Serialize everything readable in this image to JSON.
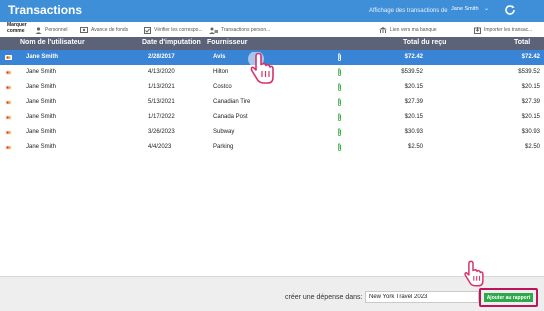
{
  "app": {
    "title": "Transactions",
    "view_label": "Affichage des transactions de",
    "selected_user": "Jane Smith"
  },
  "toolbar": {
    "mark_as_line1": "Marquer",
    "mark_as_line2": "comme",
    "items": [
      {
        "label": "Personnel",
        "icon": "person-icon"
      },
      {
        "label": "Avance de fonds",
        "icon": "cash-advance-icon"
      },
      {
        "label": "Vérifier les correspo...",
        "icon": "verify-match-icon"
      },
      {
        "label": "Transactions person...",
        "icon": "personal-transactions-icon"
      },
      {
        "label": "Lien vers ma banque",
        "icon": "bank-link-icon"
      },
      {
        "label": "Importer les transac...",
        "icon": "import-icon"
      }
    ]
  },
  "table": {
    "columns": {
      "user": "Nom de l'utilisateur",
      "date": "Date d'imputation",
      "vendor": "Fournisseur",
      "total_receipt": "Total du reçu",
      "total": "Total"
    },
    "rows": [
      {
        "user": "Jane Smith",
        "date": "2/28/2017",
        "vendor": "Avis",
        "total_receipt": "$72.42",
        "total": "$72.42",
        "selected": true
      },
      {
        "user": "Jane Smith",
        "date": "4/13/2020",
        "vendor": "Hilton",
        "total_receipt": "$539.52",
        "total": "$539.52"
      },
      {
        "user": "Jane Smith",
        "date": "1/13/2021",
        "vendor": "Costco",
        "total_receipt": "$20.15",
        "total": "$20.15"
      },
      {
        "user": "Jane Smith",
        "date": "5/13/2021",
        "vendor": "Canadian Tire",
        "total_receipt": "$27.39",
        "total": "$27.39"
      },
      {
        "user": "Jane Smith",
        "date": "1/17/2022",
        "vendor": "Canada Post",
        "total_receipt": "$20.15",
        "total": "$20.15"
      },
      {
        "user": "Jane Smith",
        "date": "3/26/2023",
        "vendor": "Subway",
        "total_receipt": "$30.93",
        "total": "$30.93"
      },
      {
        "user": "Jane Smith",
        "date": "4/4/2023",
        "vendor": "Parking",
        "total_receipt": "$2.50",
        "total": "$2.50"
      }
    ]
  },
  "footer": {
    "label": "créer une dépense dans:",
    "report_value": "New York Travel 2023",
    "add_button": "Ajouter au rapport"
  },
  "colors": {
    "titlebar": "#3f8fd8",
    "header": "#5c6378",
    "selected_row": "#3a84d6",
    "add_button": "#2ea84b",
    "highlight": "#c0145a",
    "pointer_hand": "#d6336c"
  }
}
